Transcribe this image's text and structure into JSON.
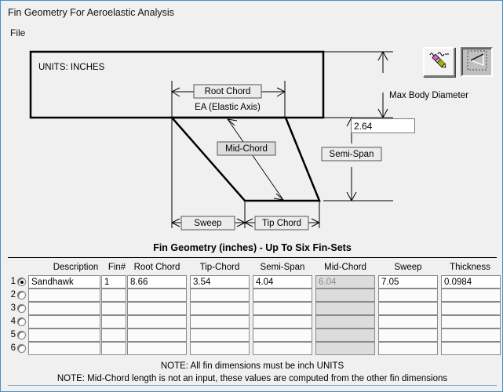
{
  "window": {
    "title": "Fin Geometry For Aeroelastic Analysis",
    "menu": [
      "File"
    ]
  },
  "diagram": {
    "units_label": "UNITS:  INCHES",
    "root_chord_label": "Root Chord",
    "ea_label": "EA (Elastic Axis)",
    "mid_chord_label": "Mid-Chord",
    "semi_span_label": "Semi-Span",
    "sweep_label": "Sweep",
    "tip_chord_label": "Tip Chord",
    "max_body_diameter_label": "Max Body Diameter",
    "max_body_diameter_value": "2.64",
    "toolbar": {
      "draw_button": "pencil-icon",
      "fin_shape_button": "fin-triangle-icon"
    }
  },
  "table": {
    "title": "Fin Geometry (inches) - Up To Six Fin-Sets",
    "columns": [
      "Description",
      "Fin#",
      "Root Chord",
      "Tip-Chord",
      "Semi-Span",
      "Mid-Chord",
      "Sweep",
      "Thickness"
    ],
    "rows": [
      {
        "num": "1",
        "selected": true,
        "cells": [
          "Sandhawk",
          "1",
          "8.66",
          "3.54",
          "4.04",
          "6.04",
          "7.05",
          "0.0984"
        ]
      },
      {
        "num": "2",
        "selected": false,
        "cells": [
          "",
          "",
          "",
          "",
          "",
          "",
          "",
          ""
        ]
      },
      {
        "num": "3",
        "selected": false,
        "cells": [
          "",
          "",
          "",
          "",
          "",
          "",
          "",
          ""
        ]
      },
      {
        "num": "4",
        "selected": false,
        "cells": [
          "",
          "",
          "",
          "",
          "",
          "",
          "",
          ""
        ]
      },
      {
        "num": "5",
        "selected": false,
        "cells": [
          "",
          "",
          "",
          "",
          "",
          "",
          "",
          ""
        ]
      },
      {
        "num": "6",
        "selected": false,
        "cells": [
          "",
          "",
          "",
          "",
          "",
          "",
          "",
          ""
        ]
      }
    ],
    "readonly_column_index": 5,
    "notes": [
      "NOTE: All fin dimensions must be inch UNITS",
      "NOTE: Mid-Chord length is not an input, these values are computed from the other fin dimensions"
    ]
  },
  "colors": {
    "background": "#f0f0f0",
    "field_bg": "#ffffff",
    "readonly_bg": "#dcdcdc",
    "label_box_bg": "#e0e0e0",
    "border": "#000000",
    "window_border": "#4a90c4"
  }
}
